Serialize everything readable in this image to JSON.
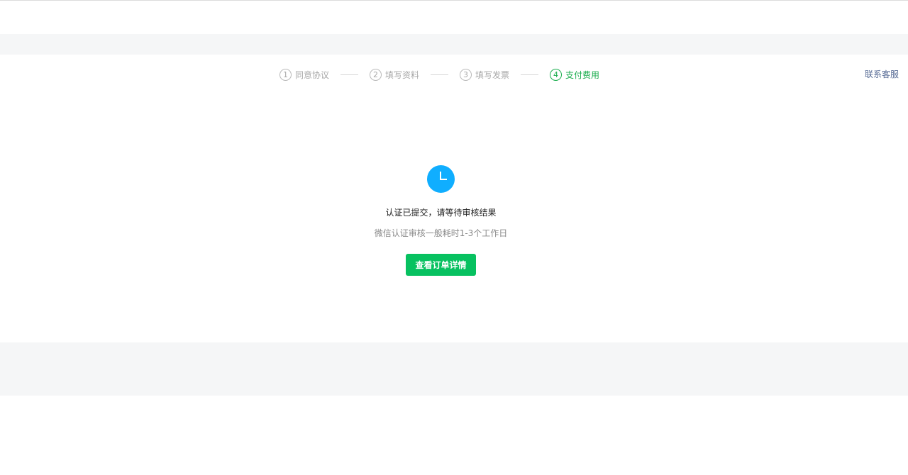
{
  "steps": [
    {
      "num": "1",
      "label": "同意协议",
      "state": "done"
    },
    {
      "num": "2",
      "label": "填写资料",
      "state": "done"
    },
    {
      "num": "3",
      "label": "填写发票",
      "state": "done"
    },
    {
      "num": "4",
      "label": "支付费用",
      "state": "active"
    }
  ],
  "header": {
    "contact_label": "联系客服"
  },
  "status": {
    "icon": "clock-icon",
    "title": "认证已提交，请等待审核结果",
    "description": "微信认证审核一般耗时1-3个工作日",
    "button_label": "查看订单详情"
  },
  "colors": {
    "accent_green": "#07c160",
    "step_active": "#1aad4d",
    "clock_blue": "#10aeff",
    "link": "#576b95"
  }
}
